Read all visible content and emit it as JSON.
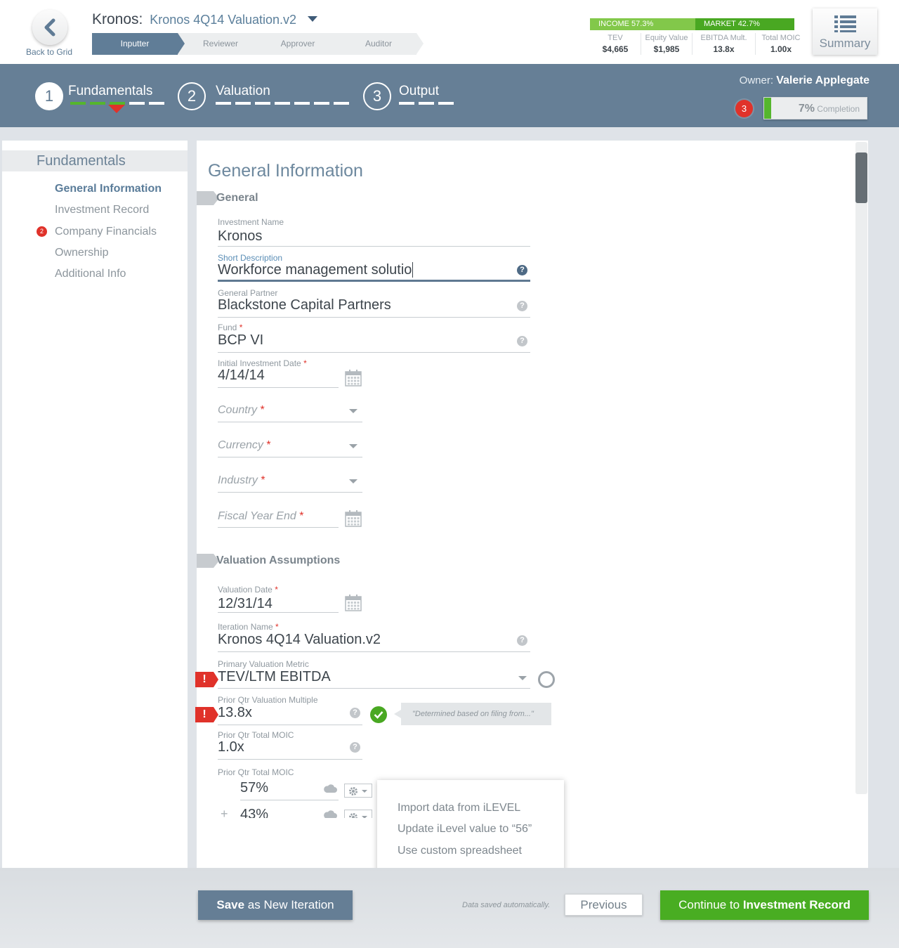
{
  "header": {
    "back_label": "Back to Grid",
    "company": "Kronos:",
    "iteration": "Kronos 4Q14 Valuation.v2",
    "roles": [
      "Inputter",
      "Reviewer",
      "Approver",
      "Auditor"
    ],
    "active_role": "Inputter",
    "mix": {
      "income_label": "INCOME 57.3%",
      "market_label": "MARKET 42.7%",
      "income_pct": 57.3,
      "market_pct": 42.7
    },
    "kpis": [
      {
        "label": "TEV",
        "value": "$4,665"
      },
      {
        "label": "Equity Value",
        "value": "$1,985"
      },
      {
        "label": "EBITDA Mult.",
        "value": "13.8x"
      },
      {
        "label": "Total MOIC",
        "value": "1.00x"
      }
    ],
    "summary_label": "Summary",
    "icons": {
      "back": "chevron-left-icon",
      "summary": "list-icon"
    },
    "colors": {
      "income": "#82c84a",
      "market": "#49a822",
      "active_role": "#607d97"
    }
  },
  "phases": [
    {
      "num": "1",
      "name": "Fundamentals",
      "active": true
    },
    {
      "num": "2",
      "name": "Valuation",
      "active": false
    },
    {
      "num": "3",
      "name": "Output",
      "active": false
    }
  ],
  "owner": {
    "label": "Owner:",
    "name": "Valerie Applegate"
  },
  "alert_count": "3",
  "completion": {
    "pct_label": "7%",
    "label": "Completion",
    "value": 0.07
  },
  "sidenav": {
    "title": "Fundamentals",
    "items": [
      {
        "label": "General Information",
        "active": true
      },
      {
        "label": "Investment Record"
      },
      {
        "label": "Company Financials",
        "badge": "2"
      },
      {
        "label": "Ownership"
      },
      {
        "label": "Additional Info"
      }
    ]
  },
  "form": {
    "title": "General Information",
    "section_general": "General",
    "section_valuation": "Valuation Assumptions",
    "investment_name": {
      "label": "Investment Name",
      "value": "Kronos"
    },
    "short_description": {
      "label": "Short Description",
      "value": "Workforce management solutio"
    },
    "general_partner": {
      "label": "General Partner",
      "value": "Blackstone Capital Partners"
    },
    "fund": {
      "label": "Fund",
      "value": "BCP VI"
    },
    "initial_investment_date": {
      "label": "Initial Investment Date",
      "value": "4/14/14"
    },
    "country": {
      "placeholder": "Country"
    },
    "currency": {
      "placeholder": "Currency"
    },
    "industry": {
      "placeholder": "Industry"
    },
    "fiscal_year_end": {
      "placeholder": "Fiscal Year End"
    },
    "valuation_date": {
      "label": "Valuation Date",
      "value": "12/31/14"
    },
    "iteration_name": {
      "label": "Iteration Name",
      "value": "Kronos 4Q14 Valuation.v2"
    },
    "primary_metric": {
      "label": "Primary Valuation Metric",
      "value": "TEV/LTM EBITDA"
    },
    "prior_multiple": {
      "label": "Prior Qtr Valuation Multiple",
      "value": "13.8x",
      "note": "\"Determined based on filing from...\""
    },
    "prior_moic": {
      "label": "Prior Qtr Total MOIC",
      "value": "1.0x"
    },
    "prior_moic_split": {
      "label": "Prior Qtr Total MOIC",
      "value_a": "57%",
      "value_b": "43%"
    },
    "required_mark": "*",
    "help_mark": "?",
    "warn_mark": "!",
    "plus_mark": "+"
  },
  "menu": {
    "items": [
      "Import data from iLEVEL",
      "Update iLevel value to “56”",
      "Use custom spreadsheet"
    ]
  },
  "footer": {
    "save_strong": "Save",
    "save_rest": " as New Iteration",
    "autosave": "Data saved automatically.",
    "previous": "Previous",
    "continue_prefix": "Continue to ",
    "continue_strong": "Investment Record"
  }
}
